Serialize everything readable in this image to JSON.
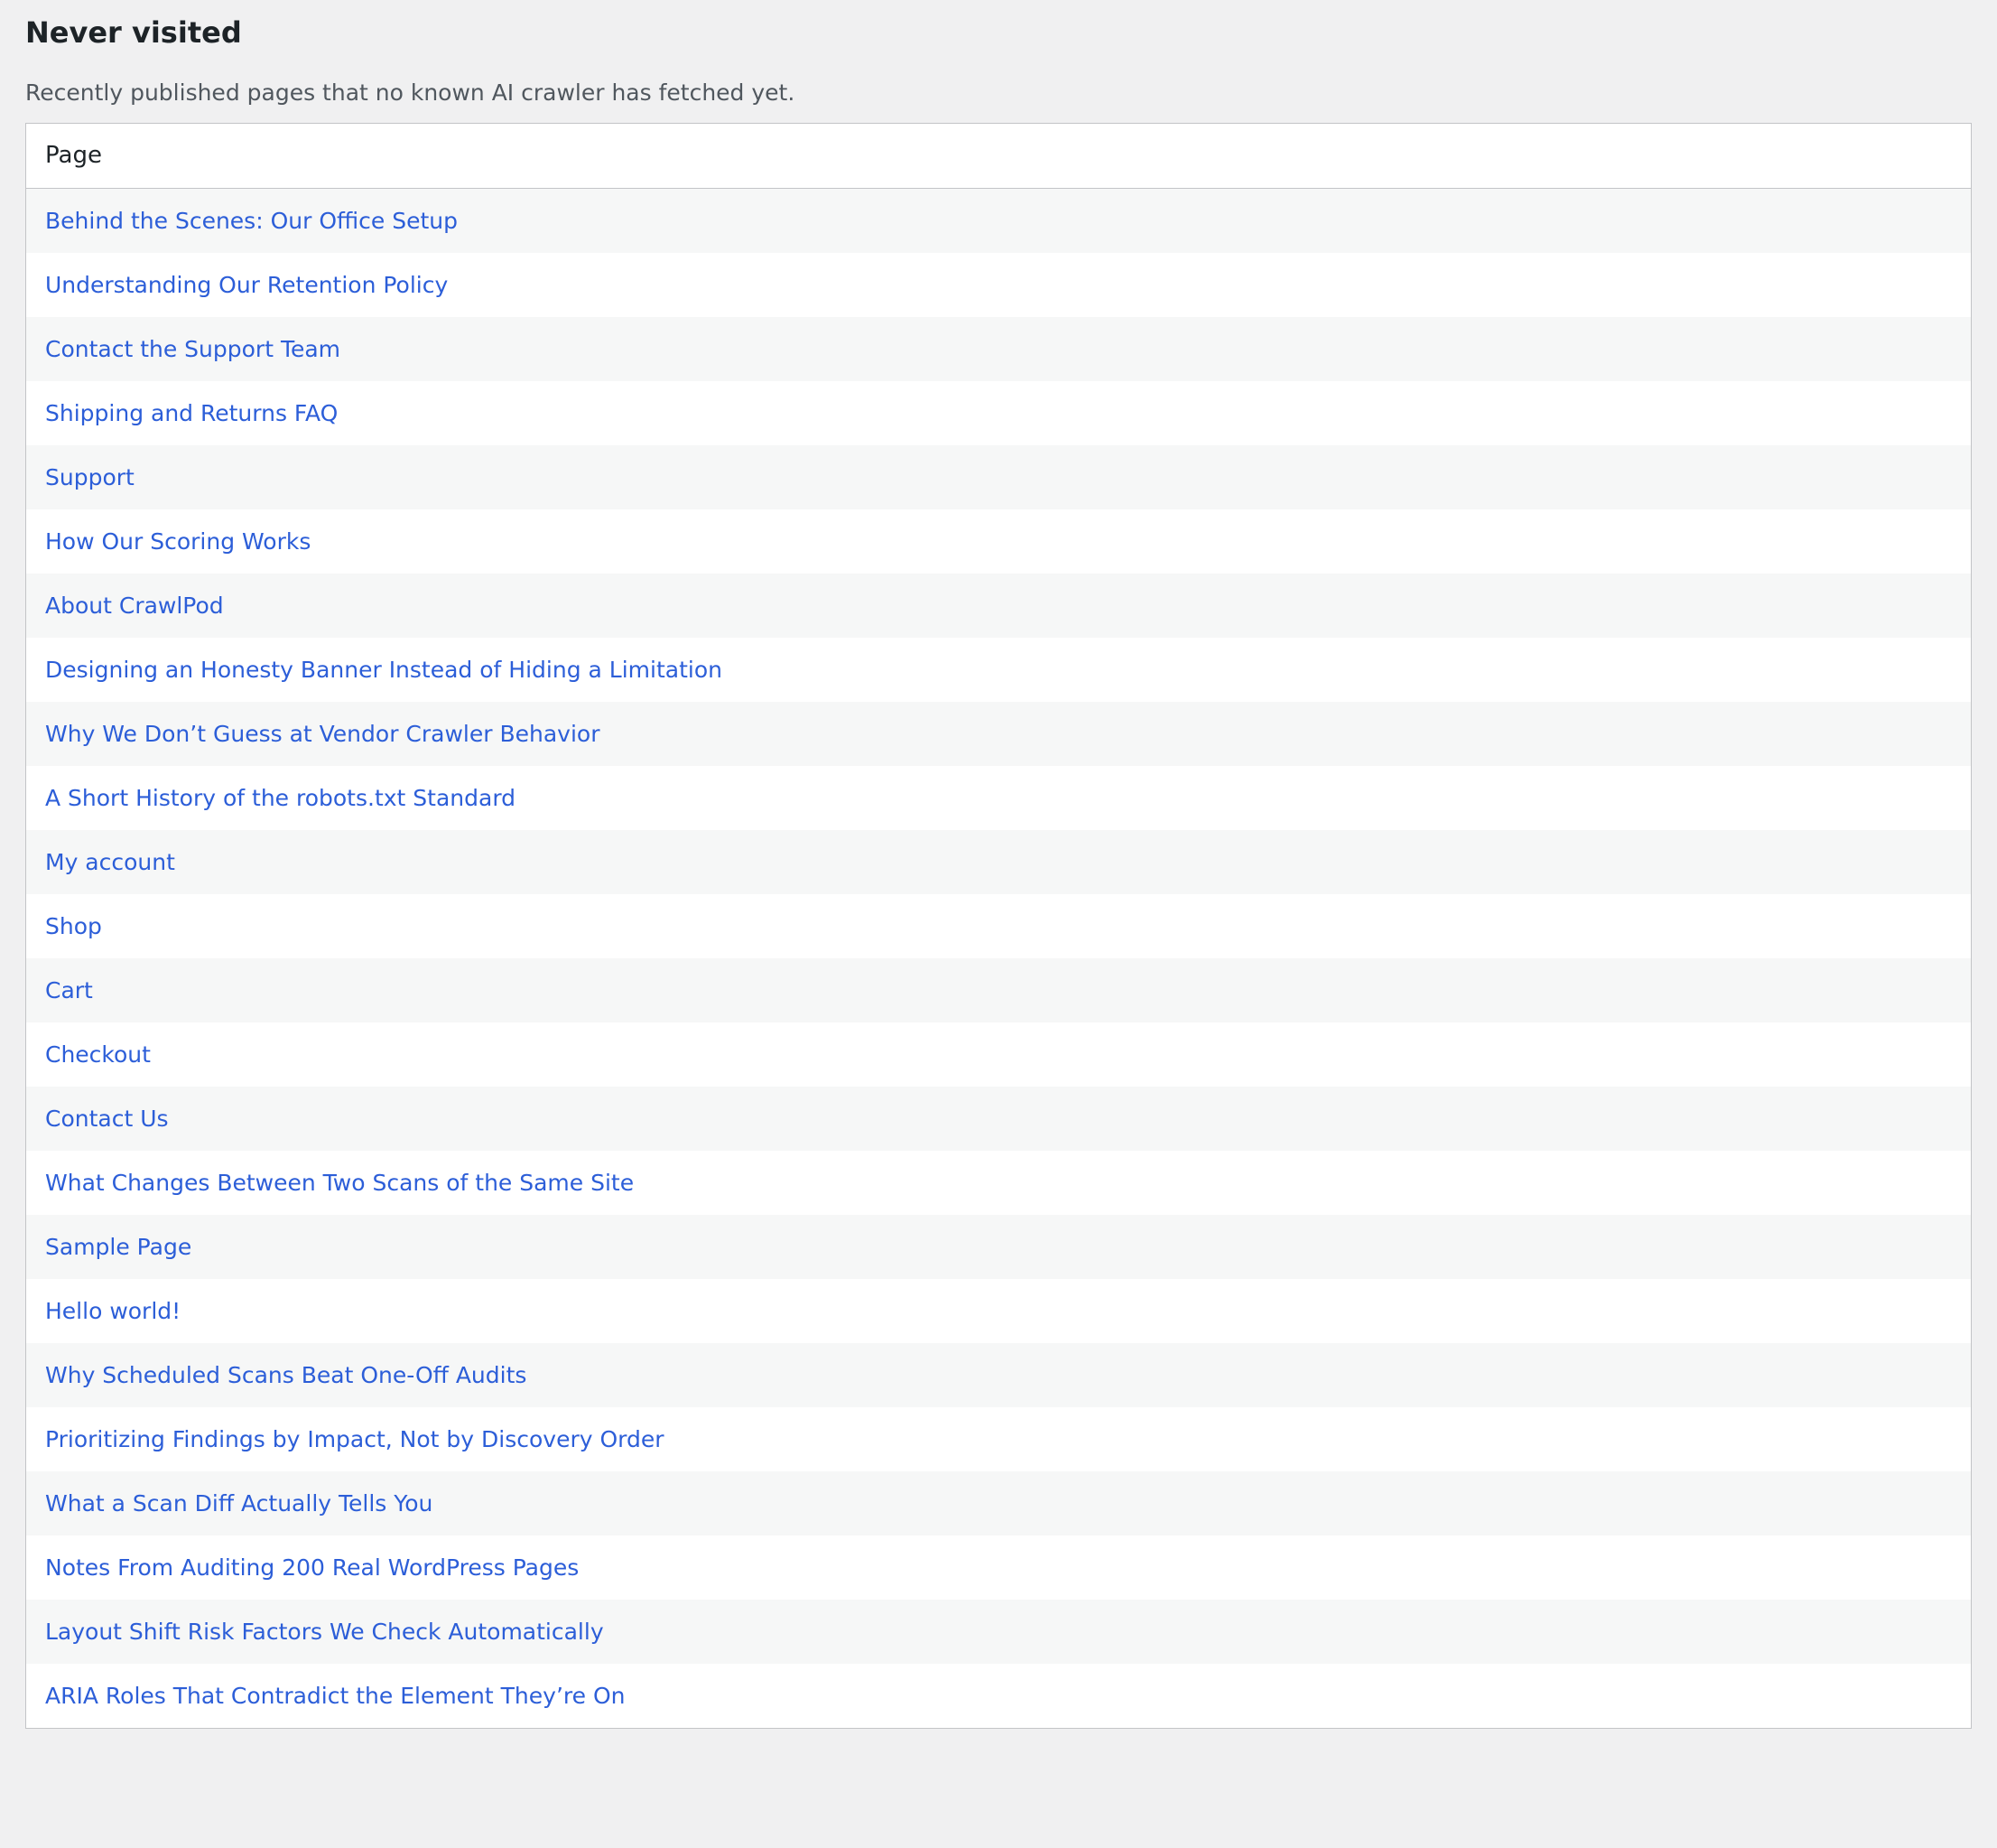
{
  "section": {
    "title": "Never visited",
    "description": "Recently published pages that no known AI crawler has fetched yet."
  },
  "table": {
    "column_header": "Page",
    "rows": [
      "Behind the Scenes: Our Office Setup",
      "Understanding Our Retention Policy",
      "Contact the Support Team",
      "Shipping and Returns FAQ",
      "Support",
      "How Our Scoring Works",
      "About CrawlPod",
      "Designing an Honesty Banner Instead of Hiding a Limitation",
      "Why We Don’t Guess at Vendor Crawler Behavior",
      "A Short History of the robots.txt Standard",
      "My account",
      "Shop",
      "Cart",
      "Checkout",
      "Contact Us",
      "What Changes Between Two Scans of the Same Site",
      "Sample Page",
      "Hello world!",
      "Why Scheduled Scans Beat One-Off Audits",
      "Prioritizing Findings by Impact, Not by Discovery Order",
      "What a Scan Diff Actually Tells You",
      "Notes From Auditing 200 Real WordPress Pages",
      "Layout Shift Risk Factors We Check Automatically",
      "ARIA Roles That Contradict the Element They’re On"
    ]
  },
  "colors": {
    "link": "#2c5ed8",
    "page_background": "#f0f0f1",
    "row_stripe": "#f6f7f7",
    "border": "#c3c4c7"
  }
}
